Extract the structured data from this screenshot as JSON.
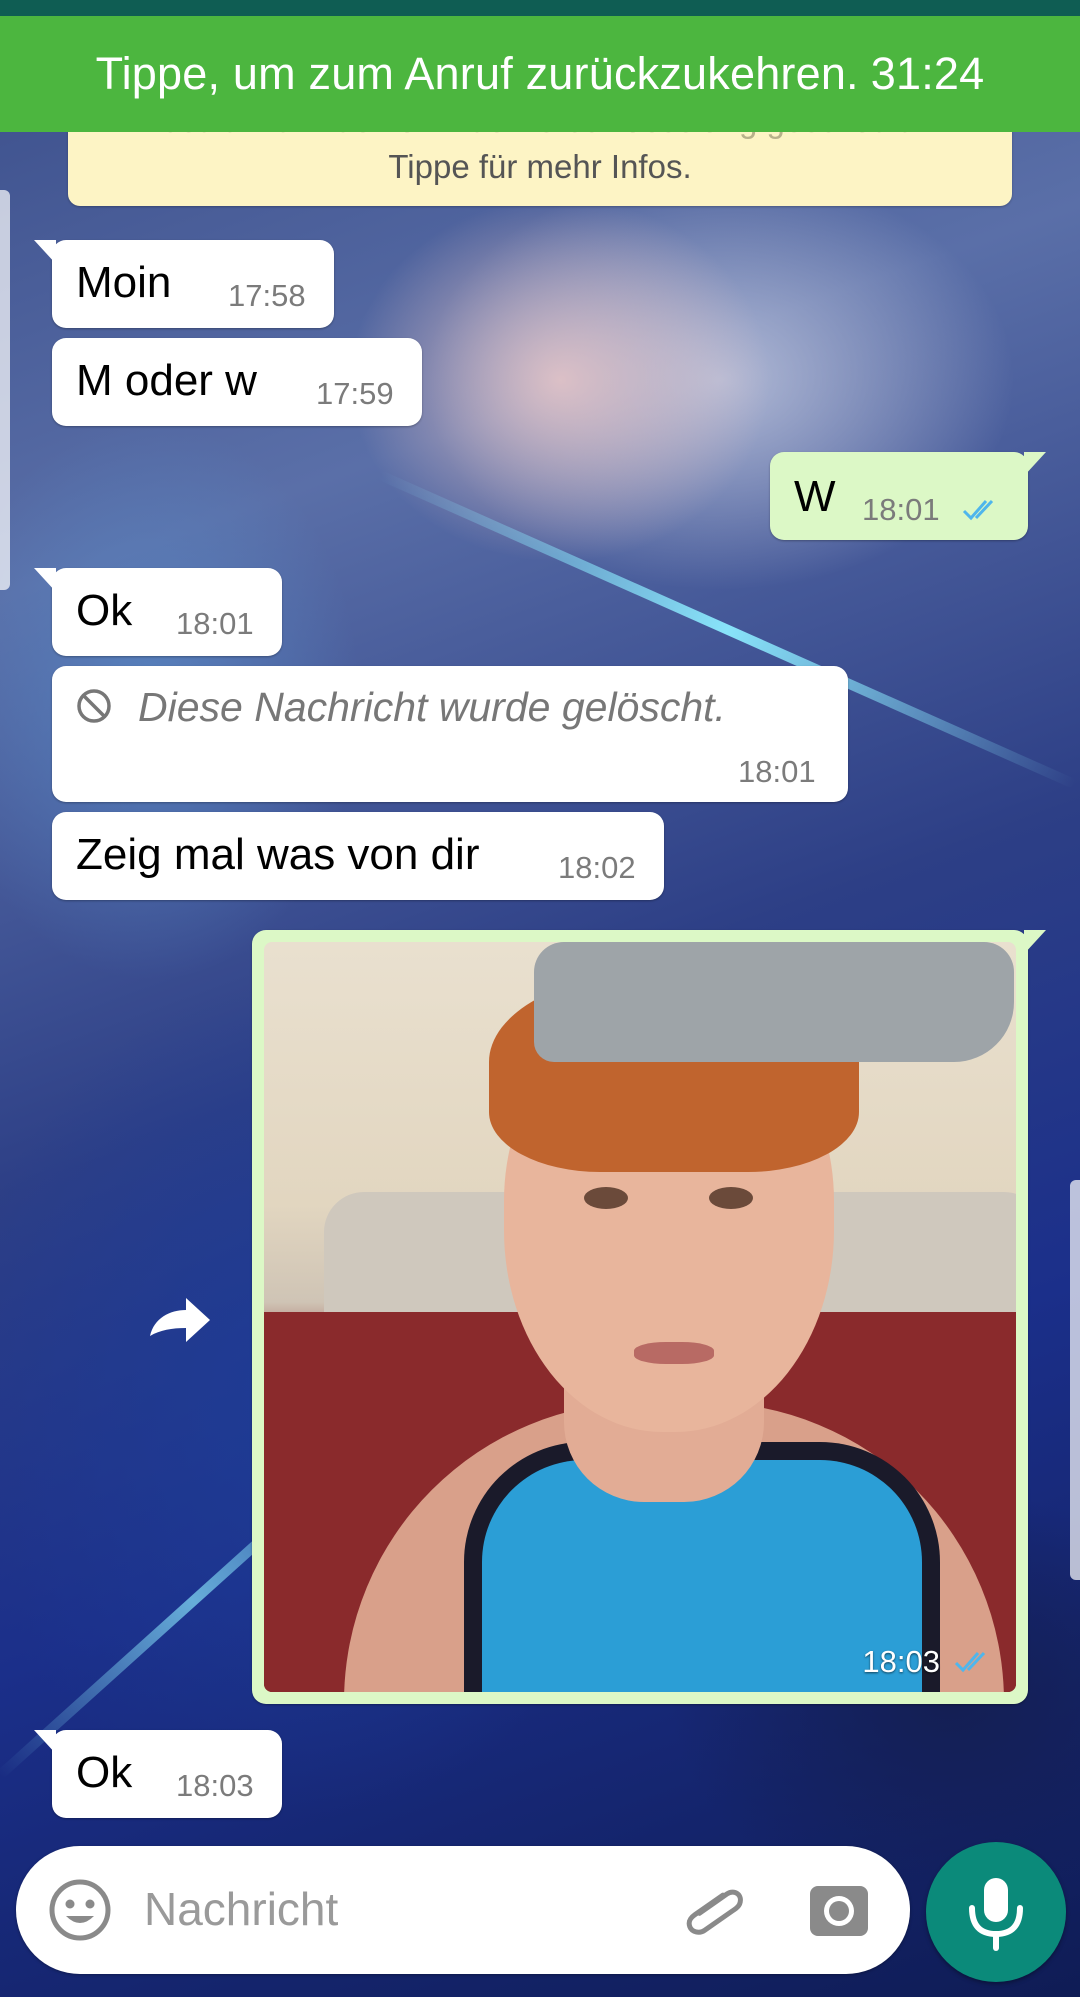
{
  "call_banner": {
    "text": "Tippe, um zum Anruf zurückzukehren.",
    "timer": "31:24"
  },
  "encryption_notice": {
    "line1": "Jetzt mit Ende-zu-Ende-Verschlüsselung geschützt.",
    "line2": "Tippe für mehr Infos."
  },
  "messages": [
    {
      "text": "Moin",
      "time": "17:58",
      "direction": "in"
    },
    {
      "text": "M oder w",
      "time": "17:59",
      "direction": "in"
    },
    {
      "text": "W",
      "time": "18:01",
      "direction": "out",
      "status": "read"
    },
    {
      "text": "Ok",
      "time": "18:01",
      "direction": "in"
    },
    {
      "text": "Diese Nachricht wurde gelöscht.",
      "time": "18:01",
      "direction": "in",
      "deleted": true
    },
    {
      "text": "Zeig mal was von dir",
      "time": "18:02",
      "direction": "in"
    },
    {
      "type": "image",
      "time": "18:03",
      "direction": "out",
      "status": "read"
    },
    {
      "text": "Ok",
      "time": "18:03",
      "direction": "in"
    }
  ],
  "composer": {
    "placeholder": "Nachricht",
    "icons": [
      "emoji-icon",
      "attachment-icon",
      "camera-icon",
      "microphone-icon"
    ]
  },
  "colors": {
    "call_banner": "#4cb63f",
    "incoming_bubble": "#ffffff",
    "outgoing_bubble": "#dcf8c6",
    "read_ticks": "#4fb6ec",
    "mic_button": "#0b8a7a",
    "notice_bg": "#fdf4c5"
  }
}
